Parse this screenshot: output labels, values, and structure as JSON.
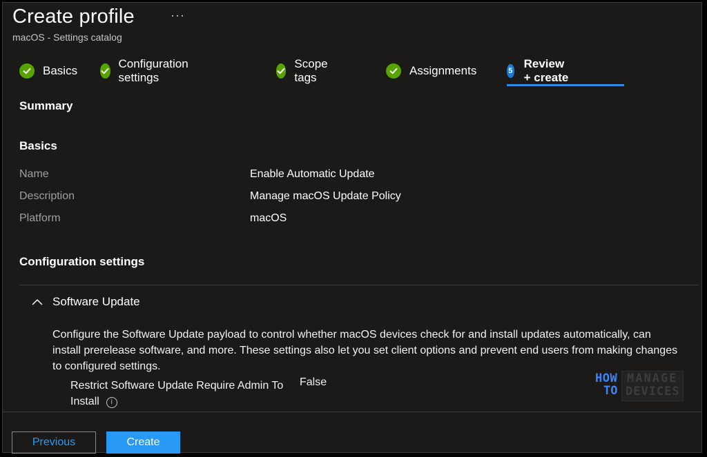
{
  "header": {
    "title": "Create profile",
    "more": "···",
    "subtitle": "macOS - Settings catalog"
  },
  "tabs": [
    {
      "label": "Basics",
      "state": "complete",
      "icon": "check-circle-icon"
    },
    {
      "label": "Configuration settings",
      "state": "complete",
      "icon": "check-circle-icon"
    },
    {
      "label": "Scope tags",
      "state": "complete",
      "icon": "check-circle-icon"
    },
    {
      "label": "Assignments",
      "state": "complete",
      "icon": "check-circle-icon"
    },
    {
      "label": "Review + create",
      "state": "active",
      "step": "5"
    }
  ],
  "summary": {
    "heading": "Summary",
    "basics_heading": "Basics",
    "rows": [
      {
        "label": "Name",
        "value": "Enable Automatic Update"
      },
      {
        "label": "Description",
        "value": "Manage macOS Update Policy"
      },
      {
        "label": "Platform",
        "value": "macOS"
      }
    ],
    "config_heading": "Configuration settings"
  },
  "software_update": {
    "title": "Software Update",
    "description": "Configure the Software Update payload to control whether macOS devices check for and install updates automatically, can install prerelease software, and more. These settings also let you set client options and prevent end users from making changes to configured settings.",
    "setting_label": "Restrict Software Update Require Admin To Install",
    "setting_value": "False"
  },
  "footer": {
    "previous_label": "Previous",
    "create_label": "Create"
  },
  "watermark": {
    "how": "HOW",
    "to": "TO",
    "manage": "MANAGE",
    "devices": "DEVICES"
  },
  "colors": {
    "background": "#1b1a19",
    "accent": "#2899f5",
    "success": "#57a300",
    "step_badge": "#1a7ad4"
  }
}
